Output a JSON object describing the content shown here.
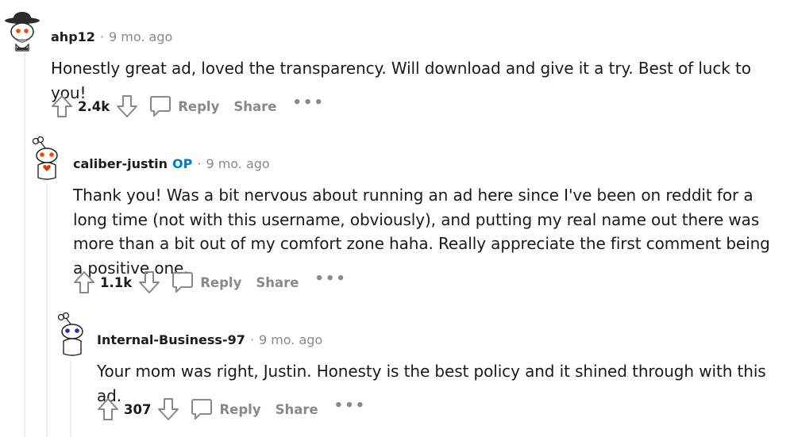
{
  "comments": [
    {
      "author": "ahp12",
      "op_badge": "",
      "separator": "·",
      "time": "9 mo. ago",
      "text": "Honestly great ad, loved the transparency. Will download and give it a try. Best of luck to you!",
      "votes": "2.4k",
      "reply_label": "Reply",
      "share_label": "Share",
      "more_label": "•••",
      "avatar_icon": "cowboy-snoo-avatar-icon"
    },
    {
      "author": "caliber-justin",
      "op_badge": "OP",
      "separator": "·",
      "time": "9 mo. ago",
      "text": "Thank you! Was a bit nervous about running an ad here since I've been on reddit for a long time (not with this username, obviously), and putting my real name out there was more than a bit out of my comfort zone haha. Really appreciate the first comment being a positive one.",
      "votes": "1.1k",
      "reply_label": "Reply",
      "share_label": "Share",
      "more_label": "•••",
      "avatar_icon": "snoo-red-heart-avatar-icon"
    },
    {
      "author": "Internal-Business-97",
      "op_badge": "",
      "separator": "·",
      "time": "9 mo. ago",
      "text": "Your mom was right, Justin. Honesty is the best policy and it shined through with this ad.",
      "votes": "307",
      "reply_label": "Reply",
      "share_label": "Share",
      "more_label": "•••",
      "avatar_icon": "snoo-blue-avatar-icon"
    }
  ],
  "colors": {
    "text": "#1a1a1b",
    "muted": "#878a8c",
    "op_blue": "#0079d3",
    "thread_line": "#edeff1"
  }
}
